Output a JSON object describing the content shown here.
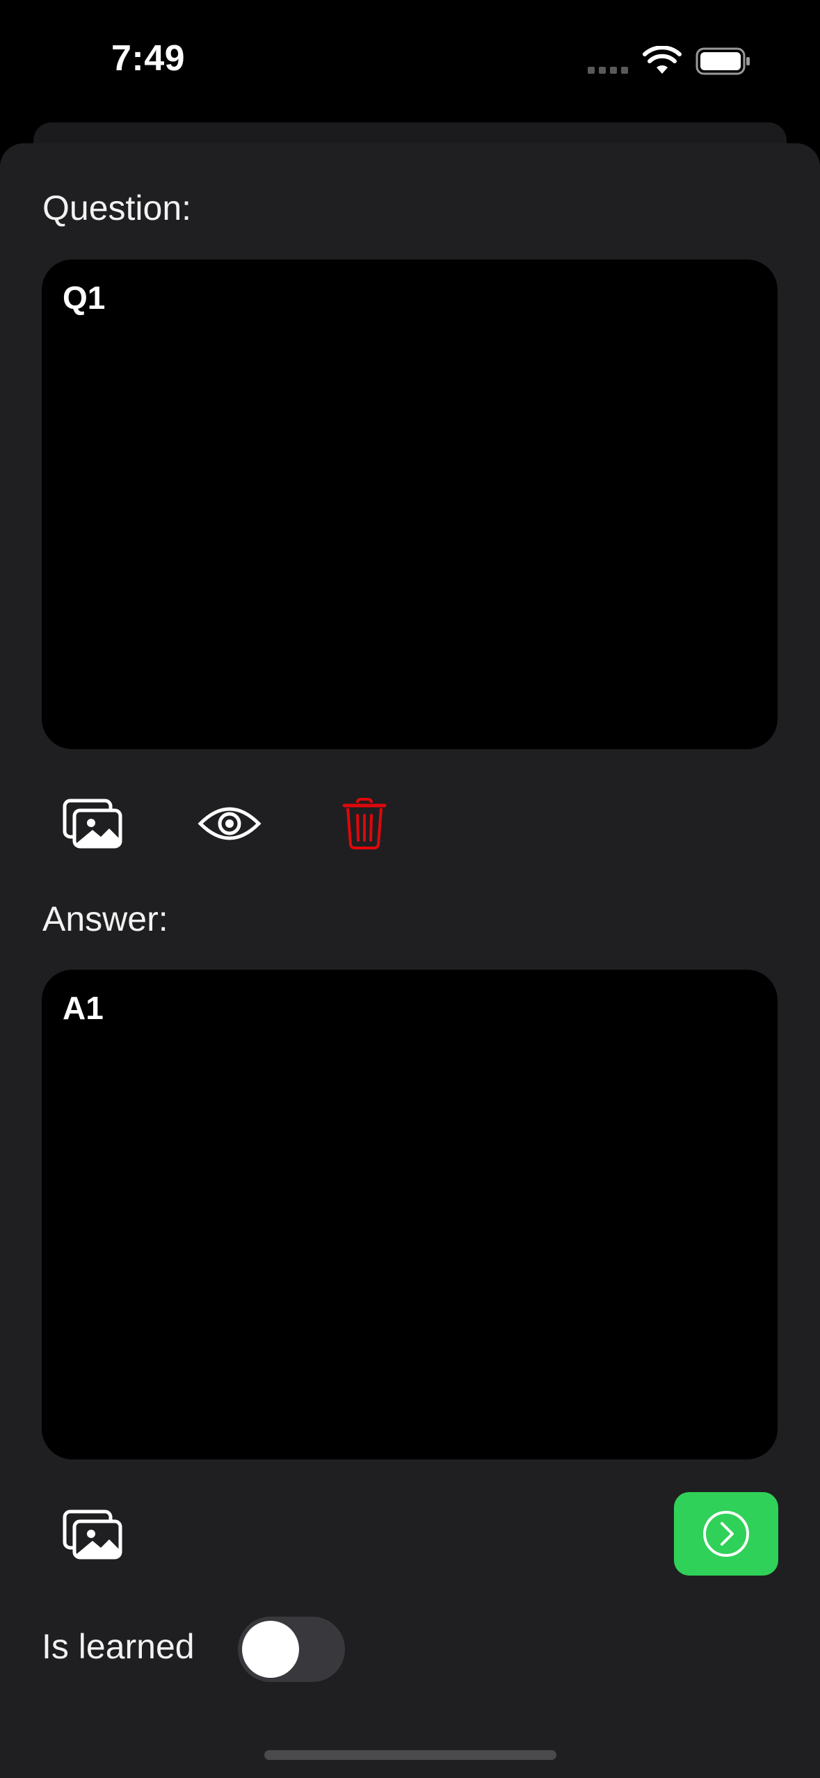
{
  "status_bar": {
    "time": "7:49",
    "icons": [
      "signal-dots-icon",
      "wifi-icon",
      "battery-icon"
    ]
  },
  "question": {
    "label": "Question:",
    "value": "Q1",
    "actions": [
      "photo-library-icon",
      "eye-icon",
      "trash-icon"
    ]
  },
  "answer": {
    "label": "Answer:",
    "value": "A1",
    "actions": [
      "photo-library-icon",
      "next-arrow-icon"
    ]
  },
  "learned": {
    "label": "Is learned",
    "on": false
  },
  "colors": {
    "background": "#000000",
    "sheet": "#1f1f21",
    "delete": "#e0070b",
    "next_button": "#30d158",
    "toggle_off": "#39393d"
  }
}
